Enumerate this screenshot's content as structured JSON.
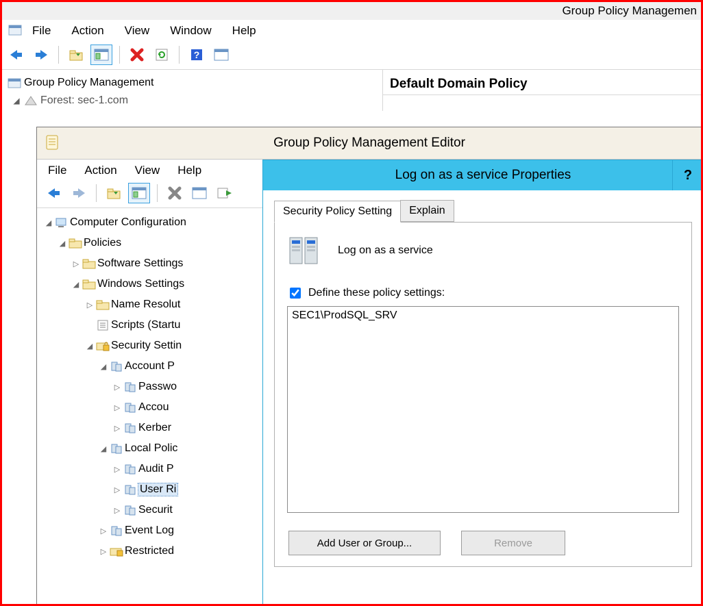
{
  "gpm": {
    "window_title": "Group Policy Managemen",
    "menu": {
      "file": "File",
      "action": "Action",
      "view": "View",
      "window": "Window",
      "help": "Help"
    },
    "tree": {
      "root": "Group Policy Management",
      "forest": "Forest: sec-1.com"
    },
    "right_panel_title": "Default Domain Policy"
  },
  "editor": {
    "window_title": "Group Policy Management Editor",
    "menu": {
      "file": "File",
      "action": "Action",
      "view": "View",
      "help": "Help"
    },
    "tree": {
      "n0": "Computer Configuration",
      "n1": "Policies",
      "n2": "Software Settings",
      "n3": "Windows Settings",
      "n4": "Name Resolut",
      "n5": "Scripts (Startu",
      "n6": "Security Settin",
      "n7": "Account P",
      "n8": "Passwo",
      "n9": "Accou",
      "n10": "Kerber",
      "n11": "Local Polic",
      "n12": "Audit P",
      "n13": "User Ri",
      "n14": "Securit",
      "n15": "Event Log",
      "n16": "Restricted"
    }
  },
  "dialog": {
    "title": "Log on as a service Properties",
    "help": "?",
    "tab_setting": "Security Policy Setting",
    "tab_explain": "Explain",
    "policy_name": "Log on as a service",
    "checkbox_label": "Define these policy settings:",
    "list_item": "SEC1\\ProdSQL_SRV",
    "btn_add": "Add User or Group...",
    "btn_remove": "Remove"
  }
}
